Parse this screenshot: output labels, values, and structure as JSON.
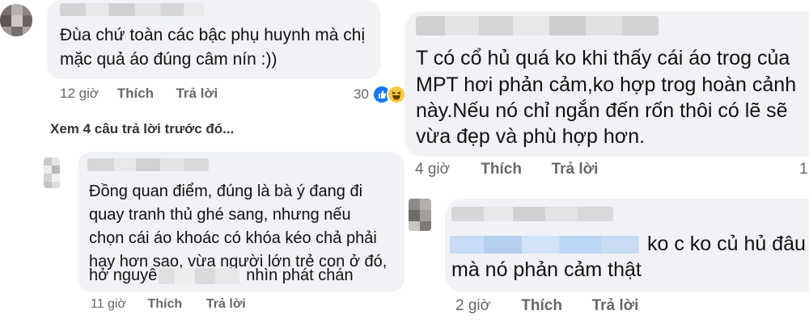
{
  "left_thread": {
    "comment_top": {
      "author": "",
      "lines": [
        "Đùa chứ toàn các bậc phụ huynh mà chị",
        "mặc quả áo đúng câm nín :))"
      ],
      "time": "12 giờ",
      "like_label": "Thích",
      "reply_label": "Trả lời",
      "reaction_count": "30",
      "reaction_icons": [
        "like-icon",
        "haha-icon"
      ]
    },
    "see_more_replies": "Xem 4 câu trả lời trước đó...",
    "reply": {
      "author": "",
      "lines": [
        "Đồng quan điểm, đúng là bà ý đang đi",
        "quay tranh thủ ghé sang, nhưng nếu",
        "chọn cái áo khoác có khóa kéo chả phải",
        "hay hơn sao, vừa người lớn trẻ con ở đó,"
      ],
      "last_line_prefix": "hở nguyê",
      "last_line_suffix": "nhìn phát chán",
      "time": "11 giờ",
      "like_label": "Thích",
      "reply_label": "Trả lời"
    }
  },
  "right_thread": {
    "comment_top": {
      "author": "",
      "lines": [
        "T có cổ hủ quá ko khi thấy cái áo trog của",
        "MPT hơi phản cảm,ko hợp trog hoàn cảnh",
        "này.Nếu nó chỉ ngắn đến rốn thôi có lẽ sẽ",
        "vừa đẹp và phù hợp hơn."
      ],
      "time": "4 giờ",
      "like_label": "Thích",
      "reply_label": "Trả lời",
      "reaction_count": "1"
    },
    "reply": {
      "author": "",
      "line1_suffix": "ko c ko củ hủ đâu",
      "line2": "mà nó phản cảm thật",
      "time": "2 giờ",
      "like_label": "Thích",
      "reply_label": "Trả lời"
    }
  },
  "colors": {
    "bubble": "#f0f2f5",
    "secondary_text": "#65676b",
    "like_blue": "#1877f2",
    "haha_yellow": "#f7c93e",
    "redacted_name_tag": "#bcd6f5"
  }
}
